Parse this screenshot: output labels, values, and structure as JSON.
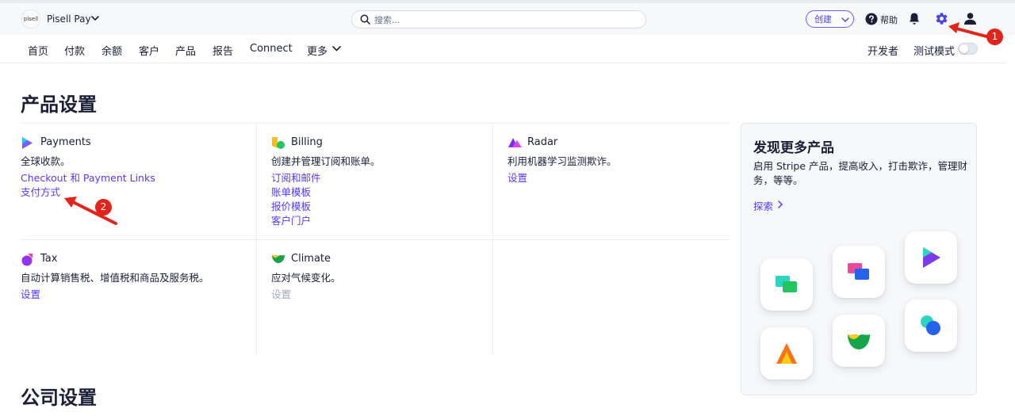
{
  "topbar": {
    "logo_text": "pisell",
    "account_name": "Pisell Pay",
    "search_placeholder": "搜索...",
    "create_label": "创建",
    "help_label": "帮助",
    "icons": [
      "chevron-down-icon",
      "search-icon",
      "help-icon",
      "bell-icon",
      "gear-icon",
      "user-icon"
    ]
  },
  "nav": {
    "items": [
      "首页",
      "付款",
      "余额",
      "客户",
      "产品",
      "报告",
      "Connect",
      "更多"
    ],
    "developer_label": "开发者",
    "test_mode_label": "测试模式",
    "test_mode_on": false
  },
  "page": {
    "product_settings_title": "产品设置",
    "company_settings_title": "公司设置"
  },
  "products": {
    "payments": {
      "title": "Payments",
      "description": "全球收款。",
      "links": [
        "Checkout 和 Payment Links",
        "支付方式"
      ]
    },
    "billing": {
      "title": "Billing",
      "description": "创建并管理订阅和账单。",
      "links": [
        "订阅和邮件",
        "账单模板",
        "报价模板",
        "客户门户"
      ]
    },
    "radar": {
      "title": "Radar",
      "description": "利用机器学习监测欺诈。",
      "links": [
        "设置"
      ]
    },
    "tax": {
      "title": "Tax",
      "description": "自动计算销售税、增值税和商品及服务税。",
      "links": [
        "设置"
      ]
    },
    "climate": {
      "title": "Climate",
      "description": "应对气候变化。",
      "links": [
        "设置"
      ]
    }
  },
  "discover": {
    "title": "发现更多产品",
    "description": "启用 Stripe 产品，提高收入，打击欺诈，管理财务，等等。",
    "link_label": "探索"
  },
  "annotations": {
    "badge_1": "1",
    "badge_2": "2",
    "color": "#e1251b"
  },
  "colors": {
    "accent": "#635bff",
    "link": "#533afd",
    "text": "#1a1f36",
    "muted": "#a3acba"
  }
}
